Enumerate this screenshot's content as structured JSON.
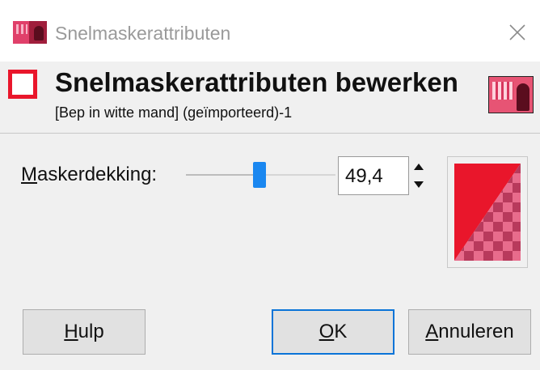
{
  "window": {
    "title": "Snelmaskerattributen",
    "close_icon": "close-icon"
  },
  "header": {
    "title": "Snelmaskerattributen bewerken",
    "subtitle": "[Bep in witte mand] (geïmporteerd)-1",
    "icon": "quick-mask-icon",
    "thumbnail": "image-thumbnail"
  },
  "opacity": {
    "label_first": "M",
    "label_rest": "askerdekking:",
    "value": "49,4",
    "slider_fraction": 0.494
  },
  "color": {
    "mask_color": "#e9162b",
    "checker_dark": "#b83a5c",
    "checker_light": "#e86c8c"
  },
  "buttons": {
    "help_first": "H",
    "help_rest": "ulp",
    "ok_first": "O",
    "ok_rest": "K",
    "cancel_first": "A",
    "cancel_rest": "nnuleren"
  }
}
